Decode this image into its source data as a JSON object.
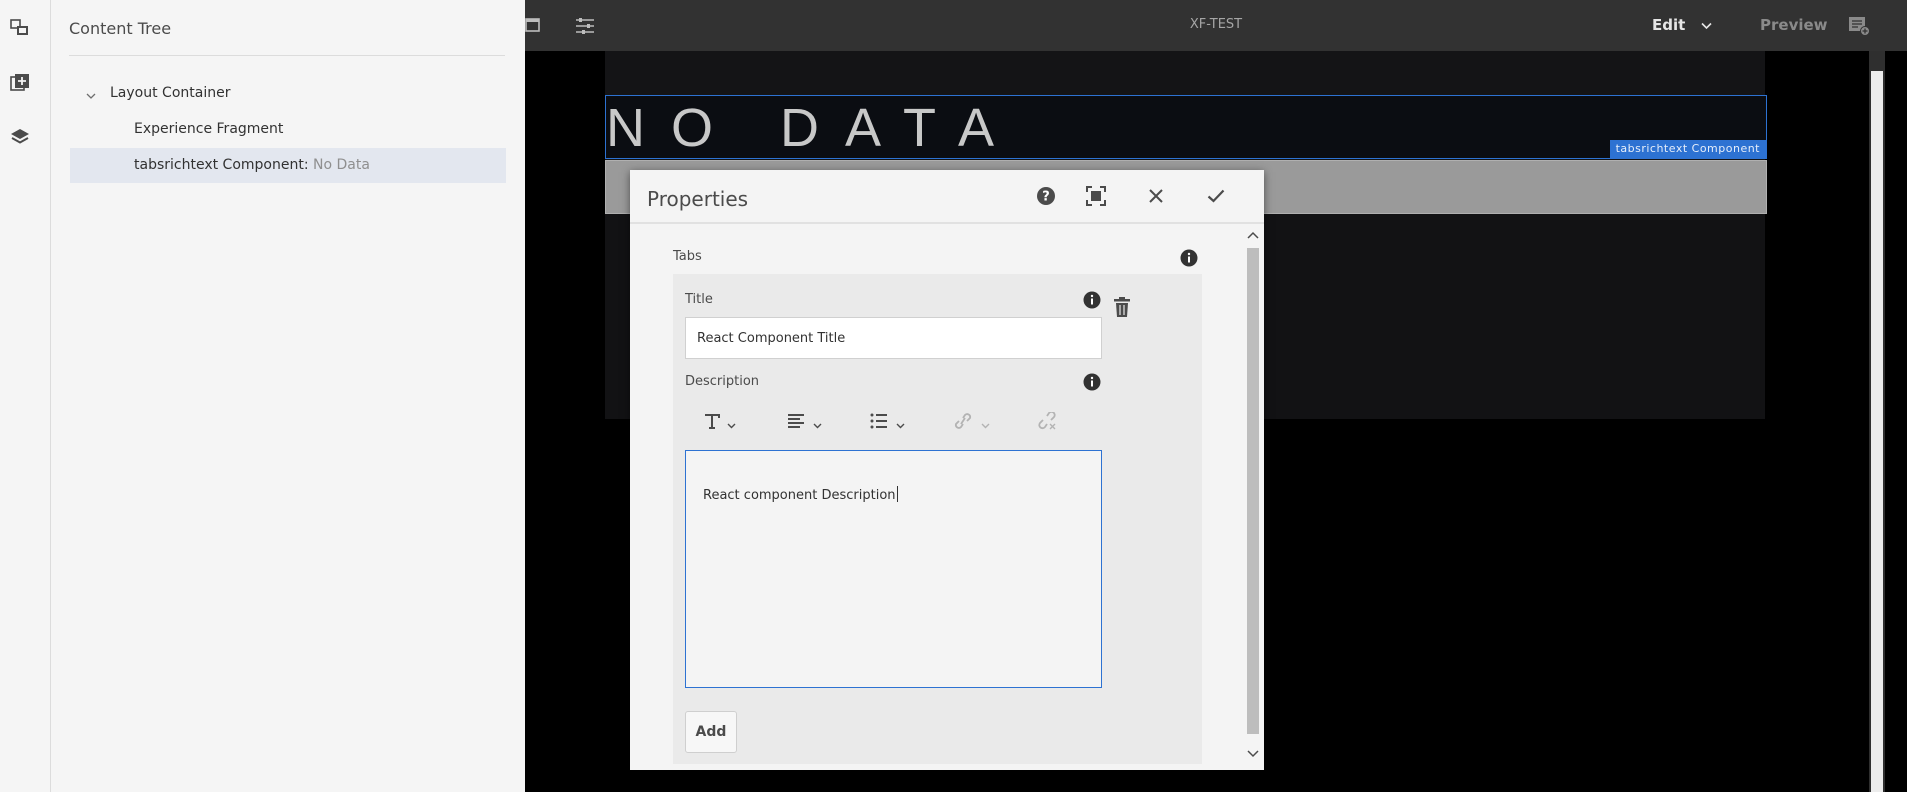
{
  "left_rail": {
    "icons": [
      "components-icon",
      "assets-icon",
      "layers-icon"
    ]
  },
  "content_tree": {
    "title": "Content Tree",
    "nodes": [
      {
        "label": "Layout Container"
      },
      {
        "label": "Experience Fragment"
      },
      {
        "label": "tabsrichtext Component:",
        "suffix": "No Data"
      }
    ]
  },
  "topbar": {
    "title": "XF-TEST",
    "mode_label": "Edit",
    "preview_label": "Preview"
  },
  "canvas": {
    "component_text": "NO DATA",
    "component_tag": "tabsrichtext Component"
  },
  "dialog": {
    "title": "Properties",
    "tabs_label": "Tabs",
    "title_label": "Title",
    "title_value": "React Component Title",
    "description_label": "Description",
    "description_value": "React component Description",
    "add_label": "Add"
  },
  "colors": {
    "accent": "#2d72d2",
    "topbar": "#323232"
  }
}
